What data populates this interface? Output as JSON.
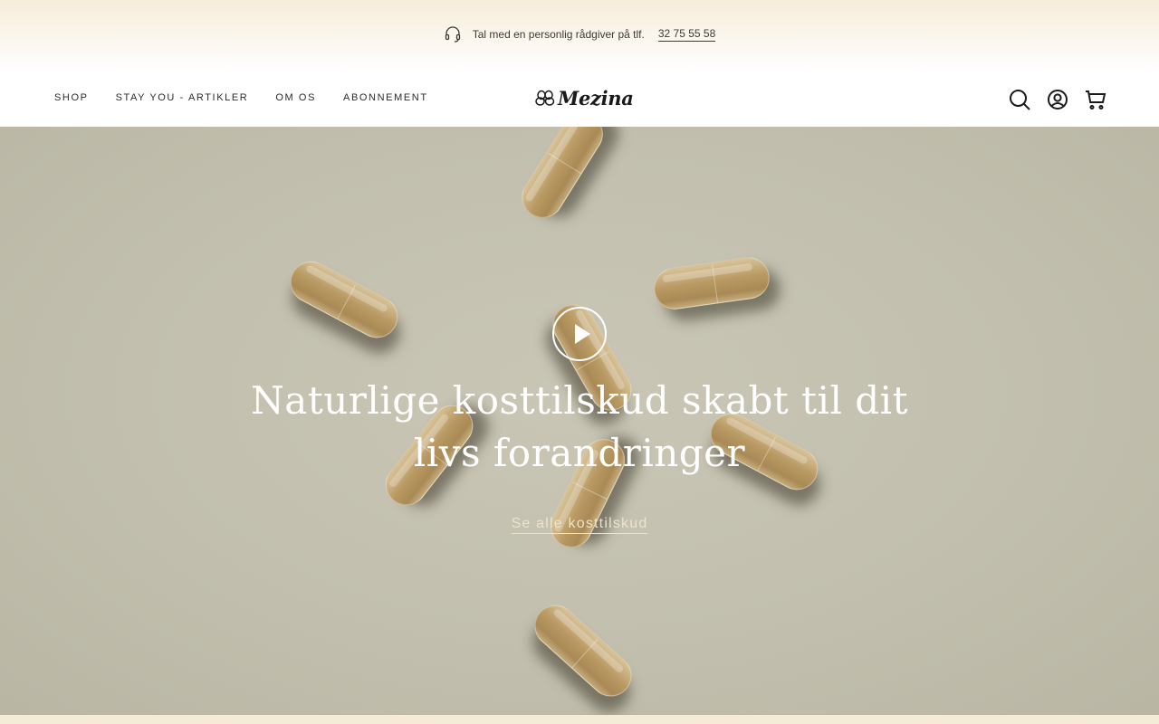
{
  "announcement": {
    "text": "Tal med en personlig rådgiver på tlf.",
    "phone": "32 75 55 58",
    "icon": "headset-icon"
  },
  "nav": {
    "items": [
      {
        "label": "SHOP"
      },
      {
        "label": "STAY YOU - ARTIKLER"
      },
      {
        "label": "OM OS"
      },
      {
        "label": "ABONNEMENT"
      }
    ]
  },
  "logo": {
    "text": "Mezina",
    "icon": "flower-logo-icon"
  },
  "header_icons": [
    "search-icon",
    "account-icon",
    "cart-icon"
  ],
  "hero": {
    "headline": "Naturlige kosttilskud skabt til dit livs forandringer",
    "cta_label": "Se alle kosttilskud",
    "play_icon": "play-icon"
  },
  "colors": {
    "announcement_bg": "#f6ecd9",
    "hero_bg": "#c6c3b2",
    "cta_text": "#ece3c9",
    "text_dark": "#2b2b2b"
  }
}
